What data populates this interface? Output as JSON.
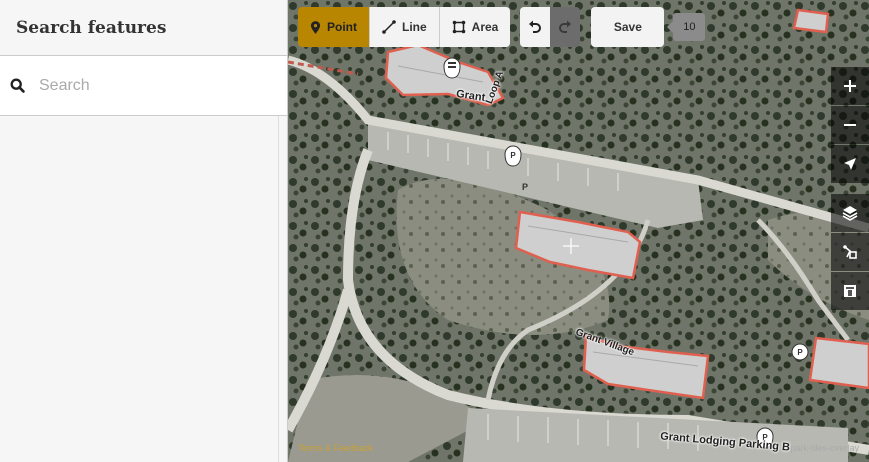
{
  "sidebar": {
    "title": "Search features",
    "search": {
      "placeholder": "Search",
      "value": ""
    }
  },
  "toolbar": {
    "modes": [
      {
        "label": "Point",
        "icon": "map-marker-icon",
        "active": true
      },
      {
        "label": "Line",
        "icon": "line-icon",
        "active": false
      },
      {
        "label": "Area",
        "icon": "area-icon",
        "active": false
      }
    ],
    "undo_icon": "undo-icon",
    "redo_icon": "redo-icon",
    "save_label": "Save",
    "save_count": "10"
  },
  "map_controls": [
    "zoom-in-icon",
    "zoom-out-icon",
    "geolocate-icon",
    "layers-icon",
    "map-data-icon",
    "issues-icon"
  ],
  "map": {
    "labels": {
      "grant_lodge": "Grant",
      "loop_a": "Loop A",
      "grant_village": "Grant Village",
      "parking_b": "Grant Lodging Parking B"
    },
    "parking_marker_letter": "P",
    "footer_left": "Terms & Feedback",
    "footer_right": "park-tiles-overlay"
  },
  "colors": {
    "accent": "#b88600",
    "building_outline": "#e06050",
    "sidebar_bg": "#f6f6f6"
  }
}
